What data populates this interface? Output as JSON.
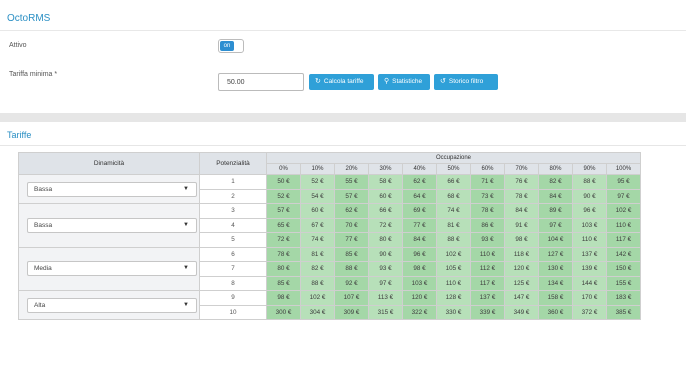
{
  "app_title": "OctoRMS",
  "form": {
    "attivo_label": "Attivo",
    "toggle_label": "on",
    "tariffa_label": "Tariffa minima *",
    "tariffa_value": "50.00",
    "buttons": [
      {
        "label": "Calcola tariffe",
        "icon": "refresh-icon",
        "glyph": "↻"
      },
      {
        "label": "Statistiche",
        "icon": "search-icon",
        "glyph": "🔍"
      },
      {
        "label": "Storico filtro",
        "icon": "history-icon",
        "glyph": "↺"
      }
    ]
  },
  "section_title": "Tariffe",
  "table": {
    "col_dinamicita": "Dinamicità",
    "col_potenzialita": "Potenzialità",
    "col_occupazione": "Occupazione",
    "occupancy": [
      "0%",
      "10%",
      "20%",
      "30%",
      "40%",
      "50%",
      "60%",
      "70%",
      "80%",
      "90%",
      "100%"
    ],
    "selects": [
      "Bassa",
      "Bassa",
      "Media",
      "Alta"
    ],
    "rows": [
      {
        "pot": "1",
        "vals": [
          "50 €",
          "52 €",
          "55 €",
          "58 €",
          "62 €",
          "66 €",
          "71 €",
          "76 €",
          "82 €",
          "88 €",
          "95 €"
        ]
      },
      {
        "pot": "2",
        "vals": [
          "52 €",
          "54 €",
          "57 €",
          "60 €",
          "64 €",
          "68 €",
          "73 €",
          "78 €",
          "84 €",
          "90 €",
          "97 €"
        ]
      },
      {
        "pot": "3",
        "vals": [
          "57 €",
          "60 €",
          "62 €",
          "66 €",
          "69 €",
          "74 €",
          "78 €",
          "84 €",
          "89 €",
          "96 €",
          "102 €"
        ]
      },
      {
        "pot": "4",
        "vals": [
          "65 €",
          "67 €",
          "70 €",
          "72 €",
          "77 €",
          "81 €",
          "86 €",
          "91 €",
          "97 €",
          "103 €",
          "110 €"
        ]
      },
      {
        "pot": "5",
        "vals": [
          "72 €",
          "74 €",
          "77 €",
          "80 €",
          "84 €",
          "88 €",
          "93 €",
          "98 €",
          "104 €",
          "110 €",
          "117 €"
        ]
      },
      {
        "pot": "6",
        "vals": [
          "78 €",
          "81 €",
          "85 €",
          "90 €",
          "96 €",
          "102 €",
          "110 €",
          "118 €",
          "127 €",
          "137 €",
          "142 €"
        ]
      },
      {
        "pot": "7",
        "vals": [
          "80 €",
          "82 €",
          "88 €",
          "93 €",
          "98 €",
          "105 €",
          "112 €",
          "120 €",
          "130 €",
          "139 €",
          "150 €"
        ]
      },
      {
        "pot": "8",
        "vals": [
          "85 €",
          "88 €",
          "92 €",
          "97 €",
          "103 €",
          "110 €",
          "117 €",
          "125 €",
          "134 €",
          "144 €",
          "155 €"
        ]
      },
      {
        "pot": "9",
        "vals": [
          "98 €",
          "102 €",
          "107 €",
          "113 €",
          "120 €",
          "128 €",
          "137 €",
          "147 €",
          "158 €",
          "170 €",
          "183 €"
        ]
      },
      {
        "pot": "10",
        "vals": [
          "300 €",
          "304 €",
          "309 €",
          "315 €",
          "322 €",
          "330 €",
          "339 €",
          "349 €",
          "360 €",
          "372 €",
          "385 €"
        ]
      }
    ]
  }
}
